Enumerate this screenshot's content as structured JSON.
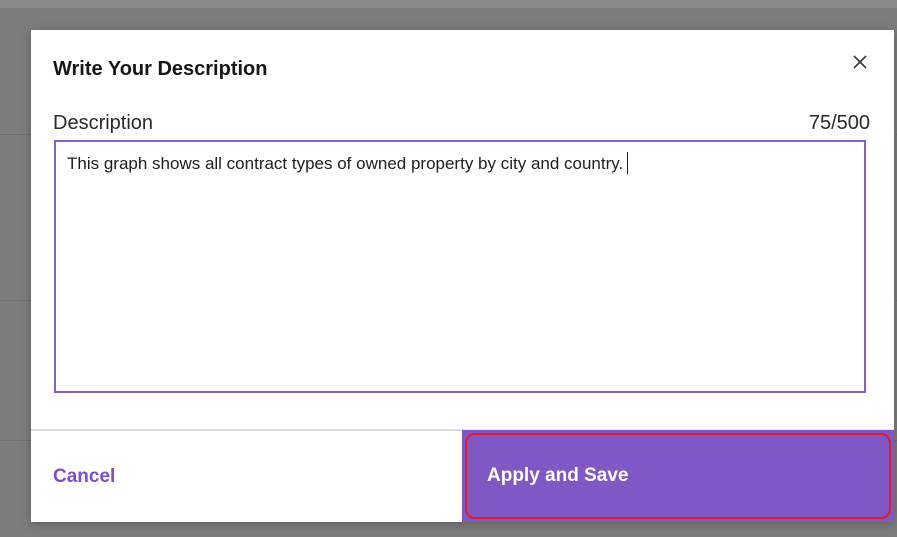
{
  "dialog": {
    "title": "Write Your Description",
    "close_icon": "close-icon"
  },
  "field": {
    "label": "Description",
    "counter": "75/500",
    "value": "This graph shows all contract types of owned property by city and country."
  },
  "footer": {
    "cancel_label": "Cancel",
    "apply_label": "Apply and Save"
  },
  "colors": {
    "accent": "#7f58c6",
    "focus_border": "#8a5cd0",
    "highlight": "#e21a2c"
  }
}
